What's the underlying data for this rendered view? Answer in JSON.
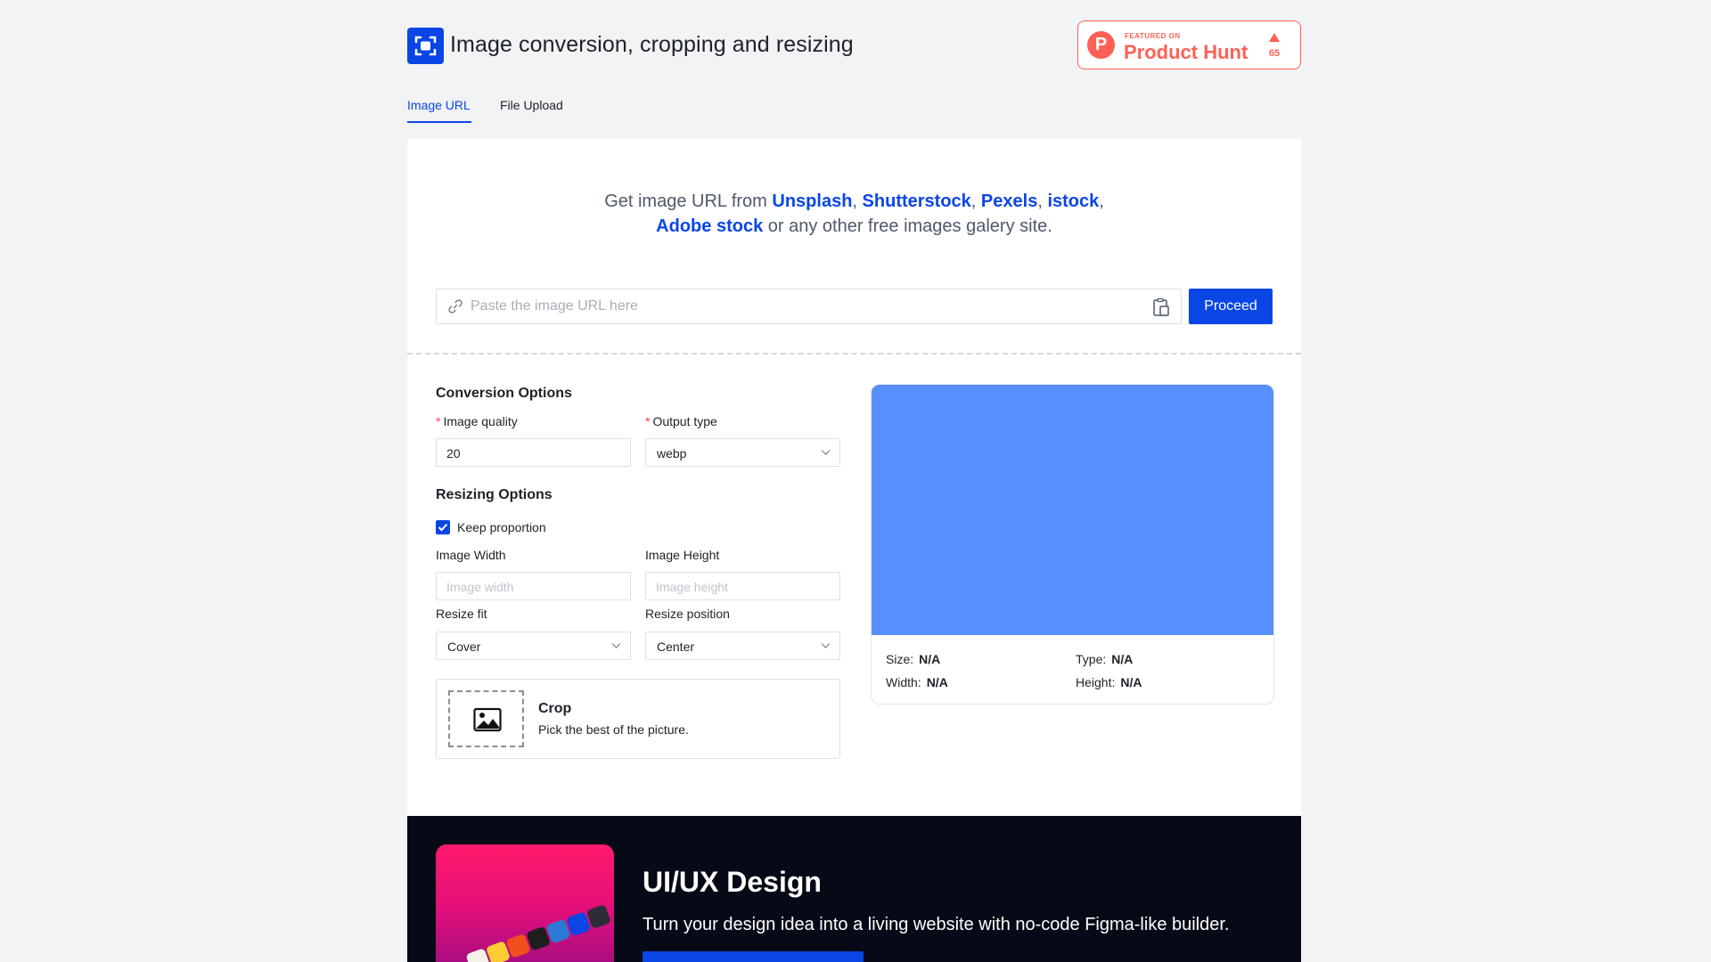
{
  "header": {
    "title": "Image conversion, cropping and resizing",
    "product_hunt": {
      "featured_on": "FEATURED ON",
      "name": "Product Hunt",
      "logo_letter": "P",
      "upvotes": "65"
    }
  },
  "tabs": [
    {
      "label": "Image URL",
      "active": true
    },
    {
      "label": "File Upload",
      "active": false
    }
  ],
  "intro": {
    "prefix": "Get image URL from ",
    "links": [
      "Unsplash",
      "Shutterstock",
      "Pexels",
      "istock",
      "Adobe stock"
    ],
    "sep": ", ",
    "trail_comma": ",",
    "suffix": " or any other free images galery site."
  },
  "url_input": {
    "placeholder": "Paste the image URL here",
    "value": ""
  },
  "proceed_label": "Proceed",
  "conversion": {
    "title": "Conversion Options",
    "required_mark": "*",
    "quality_label": "Image quality",
    "quality_value": "20",
    "output_label": "Output type",
    "output_value": "webp"
  },
  "resizing": {
    "title": "Resizing Options",
    "keep_proportion_label": "Keep proportion",
    "keep_proportion_checked": true,
    "width_label": "Image Width",
    "width_placeholder": "Image width",
    "height_label": "Image Height",
    "height_placeholder": "Image height",
    "fit_label": "Resize fit",
    "fit_value": "Cover",
    "position_label": "Resize position",
    "position_value": "Center"
  },
  "crop": {
    "title": "Crop",
    "description": "Pick the best of the picture."
  },
  "preview": {
    "size_label": "Size:",
    "size_value": "N/A",
    "type_label": "Type:",
    "type_value": "N/A",
    "width_label": "Width:",
    "width_value": "N/A",
    "height_label": "Height:",
    "height_value": "N/A",
    "placeholder_color": "#578ffd"
  },
  "promo": {
    "title": "UI/UX Design",
    "subtitle": "Turn your design idea into a living website with no-code Figma-like builder."
  },
  "colors": {
    "accent": "#0a45e6",
    "product_hunt": "#ff6154",
    "background": "#f2f3f5",
    "promo_background": "#050a16"
  }
}
